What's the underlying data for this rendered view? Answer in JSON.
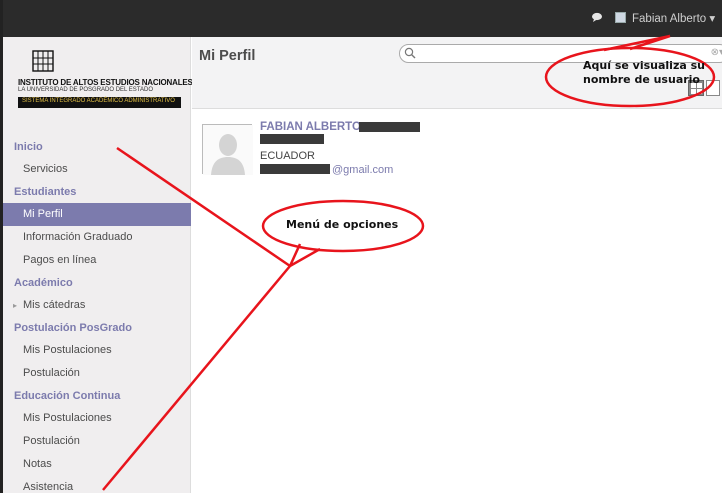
{
  "topbar": {
    "user_name": "Fabian Alberto",
    "user_menu_caret": "▾",
    "chat_icon": "chat-bubble-icon",
    "avatar_icon": "user-avatar-icon"
  },
  "sidebar": {
    "logo": {
      "title": "INSTITUTO DE ALTOS ESTUDIOS NACIONALES",
      "subtitle": "LA UNIVERSIDAD DE POSGRADO DEL ESTADO",
      "band": "SISTEMA INTEGRADO ACADÉMICO ADMINISTRATIVO"
    },
    "sections": [
      {
        "label": "Inicio",
        "items": [
          {
            "label": "Servicios"
          }
        ]
      },
      {
        "label": "Estudiantes",
        "items": [
          {
            "label": "Mi Perfil",
            "active": true
          },
          {
            "label": "Información Graduado"
          },
          {
            "label": "Pagos en línea"
          }
        ]
      },
      {
        "label": "Académico",
        "items": [
          {
            "label": "Mis cátedras",
            "caret": "▸"
          }
        ]
      },
      {
        "label": "Postulación PosGrado",
        "items": [
          {
            "label": "Mis Postulaciones"
          },
          {
            "label": "Postulación"
          }
        ]
      },
      {
        "label": "Educación Continua",
        "items": [
          {
            "label": "Mis Postulaciones"
          },
          {
            "label": "Postulación"
          },
          {
            "label": "Notas"
          },
          {
            "label": "Asistencia"
          }
        ]
      }
    ]
  },
  "main": {
    "title": "Mi Perfil",
    "search": {
      "value": "",
      "placeholder": "",
      "clear": "⊗▾"
    }
  },
  "profile": {
    "name": "FABIAN ALBERTO",
    "country": "ECUADOR",
    "email_domain": "@gmail.com"
  },
  "annotations": {
    "username_note_line1": "Aquí se visualiza su",
    "username_note_line2": "nombre de usuario",
    "menu_note": "Menú de opciones",
    "color": "#e8141c"
  },
  "colors": {
    "accent": "#7c7bad",
    "topbar": "#2b2b2b",
    "sidebar_bg": "#f0eeef"
  }
}
